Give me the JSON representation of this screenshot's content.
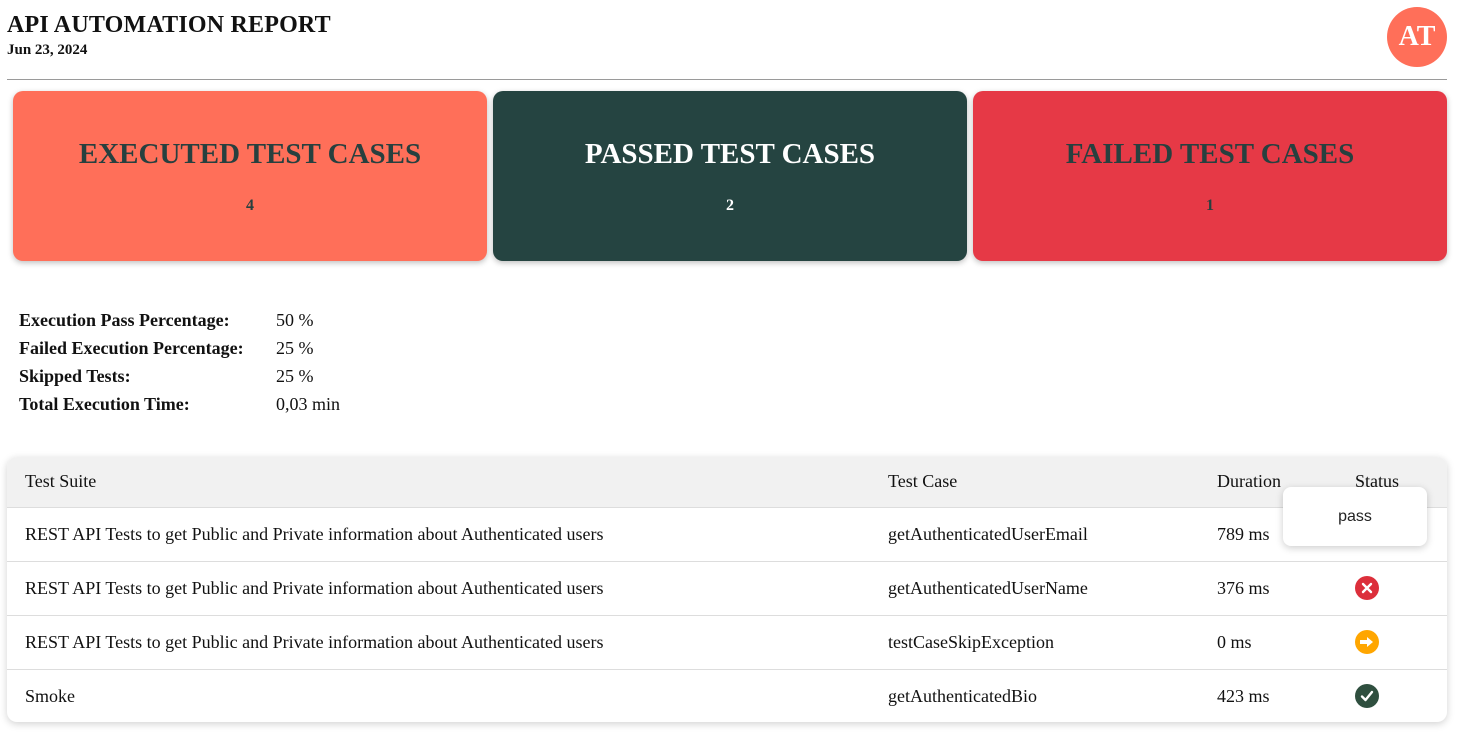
{
  "header": {
    "title": "API AUTOMATION REPORT",
    "date": "Jun 23, 2024",
    "avatar_initials": "AT"
  },
  "cards": {
    "executed": {
      "label": "EXECUTED TEST CASES",
      "value": "4"
    },
    "passed": {
      "label": "PASSED TEST CASES",
      "value": "2"
    },
    "failed": {
      "label": "FAILED TEST CASES",
      "value": "1"
    }
  },
  "stats": [
    {
      "label": "Execution Pass Percentage:",
      "value": "50 %"
    },
    {
      "label": "Failed Execution Percentage:",
      "value": "25 %"
    },
    {
      "label": "Skipped Tests:",
      "value": "25 %"
    },
    {
      "label": "Total Execution Time:",
      "value": "0,03 min"
    }
  ],
  "table": {
    "columns": [
      "Test Suite",
      "Test Case",
      "Duration",
      "Status"
    ],
    "rows": [
      {
        "suite": "REST API Tests to get Public and Private information about Authenticated users",
        "case": "getAuthenticatedUserEmail",
        "duration": "789 ms",
        "status": "pass"
      },
      {
        "suite": "REST API Tests to get Public and Private information about Authenticated users",
        "case": "getAuthenticatedUserName",
        "duration": "376 ms",
        "status": "fail"
      },
      {
        "suite": "REST API Tests to get Public and Private information about Authenticated users",
        "case": "testCaseSkipException",
        "duration": "0 ms",
        "status": "skip"
      },
      {
        "suite": "Smoke",
        "case": "getAuthenticatedBio",
        "duration": "423 ms",
        "status": "pass"
      }
    ]
  },
  "tooltip": {
    "text": "pass"
  },
  "colors": {
    "executed": "#ff6f59",
    "passed": "#254441",
    "failed": "#e63946",
    "status_fail": "#dc2f3b",
    "status_skip": "#ffa600",
    "status_pass": "#2f4f3f"
  },
  "icons": {
    "fail": "x-circle-icon",
    "skip": "arrow-right-circle-icon",
    "pass": "check-circle-icon"
  }
}
